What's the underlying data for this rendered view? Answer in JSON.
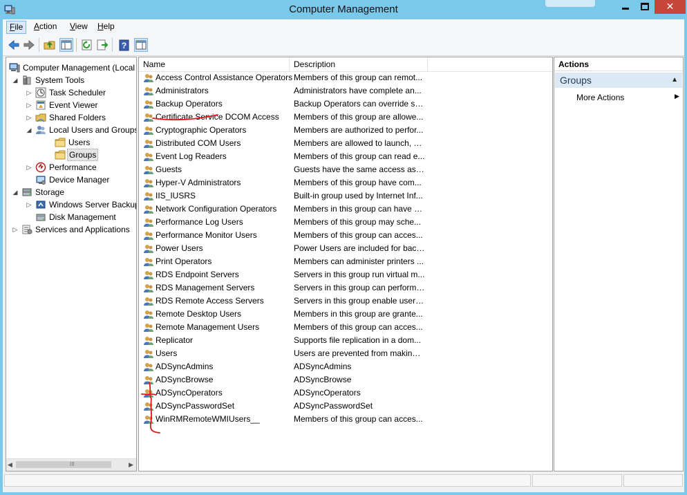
{
  "window": {
    "title": "Computer Management"
  },
  "menu": {
    "file": "File",
    "action": "Action",
    "view": "View",
    "help": "Help"
  },
  "toolbar": {
    "icons": [
      "back-arrow-icon",
      "forward-arrow-icon",
      "up-folder-icon",
      "show-hide-tree-icon",
      "refresh-icon",
      "export-list-icon",
      "help-icon",
      "show-hide-action-pane-icon"
    ]
  },
  "tree": {
    "items": [
      {
        "label": "Computer Management (Local"
      },
      {
        "label": "System Tools"
      },
      {
        "label": "Task Scheduler"
      },
      {
        "label": "Event Viewer"
      },
      {
        "label": "Shared Folders"
      },
      {
        "label": "Local Users and Groups"
      },
      {
        "label": "Users"
      },
      {
        "label": "Groups"
      },
      {
        "label": "Performance"
      },
      {
        "label": "Device Manager"
      },
      {
        "label": "Storage"
      },
      {
        "label": "Windows Server Backup"
      },
      {
        "label": "Disk Management"
      },
      {
        "label": "Services and Applications"
      }
    ],
    "selected": "Groups",
    "scrollbar_grip": "III"
  },
  "list": {
    "columns": {
      "name": "Name",
      "description": "Description"
    },
    "rows": [
      {
        "name": "Access Control Assistance Operators",
        "description": "Members of this group can remot..."
      },
      {
        "name": "Administrators",
        "description": "Administrators have complete an..."
      },
      {
        "name": "Backup Operators",
        "description": "Backup Operators can override se..."
      },
      {
        "name": "Certificate Service DCOM Access",
        "description": "Members of this group are allowe..."
      },
      {
        "name": "Cryptographic Operators",
        "description": "Members are authorized to perfor..."
      },
      {
        "name": "Distributed COM Users",
        "description": "Members are allowed to launch, a..."
      },
      {
        "name": "Event Log Readers",
        "description": "Members of this group can read e..."
      },
      {
        "name": "Guests",
        "description": "Guests have the same access as m..."
      },
      {
        "name": "Hyper-V Administrators",
        "description": "Members of this group have com..."
      },
      {
        "name": "IIS_IUSRS",
        "description": "Built-in group used by Internet Inf..."
      },
      {
        "name": "Network Configuration Operators",
        "description": "Members in this group can have s..."
      },
      {
        "name": "Performance Log Users",
        "description": "Members of this group may sche..."
      },
      {
        "name": "Performance Monitor Users",
        "description": "Members of this group can acces..."
      },
      {
        "name": "Power Users",
        "description": "Power Users are included for back..."
      },
      {
        "name": "Print Operators",
        "description": "Members can administer printers ..."
      },
      {
        "name": "RDS Endpoint Servers",
        "description": "Servers in this group run virtual m..."
      },
      {
        "name": "RDS Management Servers",
        "description": "Servers in this group can perform ..."
      },
      {
        "name": "RDS Remote Access Servers",
        "description": "Servers in this group enable users ..."
      },
      {
        "name": "Remote Desktop Users",
        "description": "Members in this group are grante..."
      },
      {
        "name": "Remote Management Users",
        "description": "Members of this group can acces..."
      },
      {
        "name": "Replicator",
        "description": "Supports file replication in a dom..."
      },
      {
        "name": "Users",
        "description": "Users are prevented from making ..."
      },
      {
        "name": "ADSyncAdmins",
        "description": "ADSyncAdmins"
      },
      {
        "name": "ADSyncBrowse",
        "description": "ADSyncBrowse"
      },
      {
        "name": "ADSyncOperators",
        "description": "ADSyncOperators"
      },
      {
        "name": "ADSyncPasswordSet",
        "description": "ADSyncPasswordSet"
      },
      {
        "name": "WinRMRemoteWMIUsers__",
        "description": "Members of this group can acces..."
      }
    ]
  },
  "actions": {
    "header": "Actions",
    "group_title": "Groups",
    "more_actions": "More Actions"
  },
  "colors": {
    "title_bar": "#7ac8ea",
    "close_button": "#c7463a",
    "annotation_red": "#e0161b",
    "actions_group_bg": "#dce8f4"
  }
}
